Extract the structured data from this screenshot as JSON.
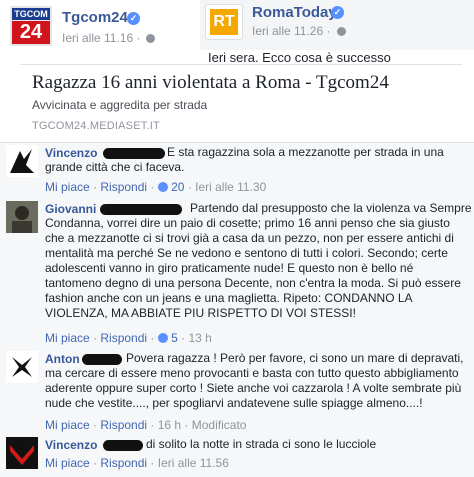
{
  "left_post": {
    "logo_top": "TGCOM",
    "logo_bottom": "24",
    "page_name": "Tgcom24",
    "timestamp": "Ieri alle 11.16 ·"
  },
  "right_post": {
    "logo": "RT",
    "page_name": "RomaToday",
    "timestamp": "Ieri alle 11.26 ·",
    "text": "Ieri sera. Ecco cosa è successo"
  },
  "link_card": {
    "title": "Ragazza 16 anni violentata a Roma - Tgcom24",
    "subtitle": "Avvicinata e aggredita per strada",
    "domain": "TGCOM24.MEDIASET.IT"
  },
  "comments": [
    {
      "name": "Vincenzo",
      "text": [
        "E sta ragazzina sola a mezzanotte per strada in una",
        "grande città che ci faceva."
      ],
      "like": "Mi piace",
      "reply": "Rispondi",
      "likes": "20",
      "time": "Ieri alle 11.30"
    },
    {
      "name": "Giovanni",
      "text": [
        "Partendo dal presupposto che la violenza va Sempre",
        "Condanna, vorrei dire un paio di cosette; primo 16 anni penso che sia giusto",
        "che a mezzanotte ci si trovi già a casa da un pezzo, non per essere antichi di",
        "mentalità ma perché Se ne vedono e sentono di tutti i colori. Secondo; certe",
        "adolescenti vanno in giro praticamente nude! E questo non è bello né",
        "tantomeno degno di una persona Decente, non c'entra la moda. Si può essere",
        "fashion anche con un jeans e una maglietta. Ripeto: CONDANNO LA",
        "VIOLENZA, MA ABBIATE PIU RISPETTO DI VOI STESSI!"
      ],
      "like": "Mi piace",
      "reply": "Rispondi",
      "likes": "5",
      "time": "13 h"
    },
    {
      "name": "Anton",
      "text": [
        "Povera ragazza ! Però per favore, ci sono un mare di depravati,",
        "ma cercare di essere meno provocanti e basta con tutto questo abbigliamento",
        "aderente oppure super corto ! Siete anche voi cazzarola ! A volte sembrate più",
        "nude che vestite...., per spogliarvi andatevene sulle spiagge almeno....!"
      ],
      "like": "Mi piace",
      "reply": "Rispondi",
      "time": "16 h",
      "modified": "Modificato"
    },
    {
      "name": "Vincenzo",
      "text": [
        "di solito la notte in strada ci sono le lucciole"
      ],
      "like": "Mi piace",
      "reply": "Rispondi",
      "time": "Ieri alle 11.56"
    }
  ]
}
